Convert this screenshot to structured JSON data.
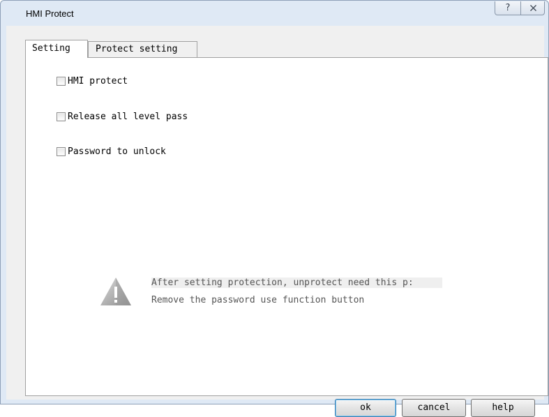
{
  "window": {
    "title": "HMI Protect",
    "help_glyph": "?",
    "close_glyph": "X"
  },
  "tabs": [
    {
      "label": "Setting",
      "selected": true
    },
    {
      "label": "Protect setting",
      "selected": false
    }
  ],
  "options": [
    {
      "label": "HMI protect",
      "checked": false
    },
    {
      "label": "Release all level pass",
      "checked": false
    },
    {
      "label": "Password to unlock",
      "checked": false
    }
  ],
  "warning": {
    "icon": "warning-triangle-icon",
    "line1": "After setting protection, unprotect need this p:",
    "line2": "Remove the password use function button"
  },
  "buttons": {
    "ok": "ok",
    "cancel": "cancel",
    "help": "help"
  },
  "colors": {
    "frame": "#dfe9f5",
    "client": "#f0f0f0",
    "panel": "#ffffff",
    "ok_focus": "#3c7fb1"
  }
}
